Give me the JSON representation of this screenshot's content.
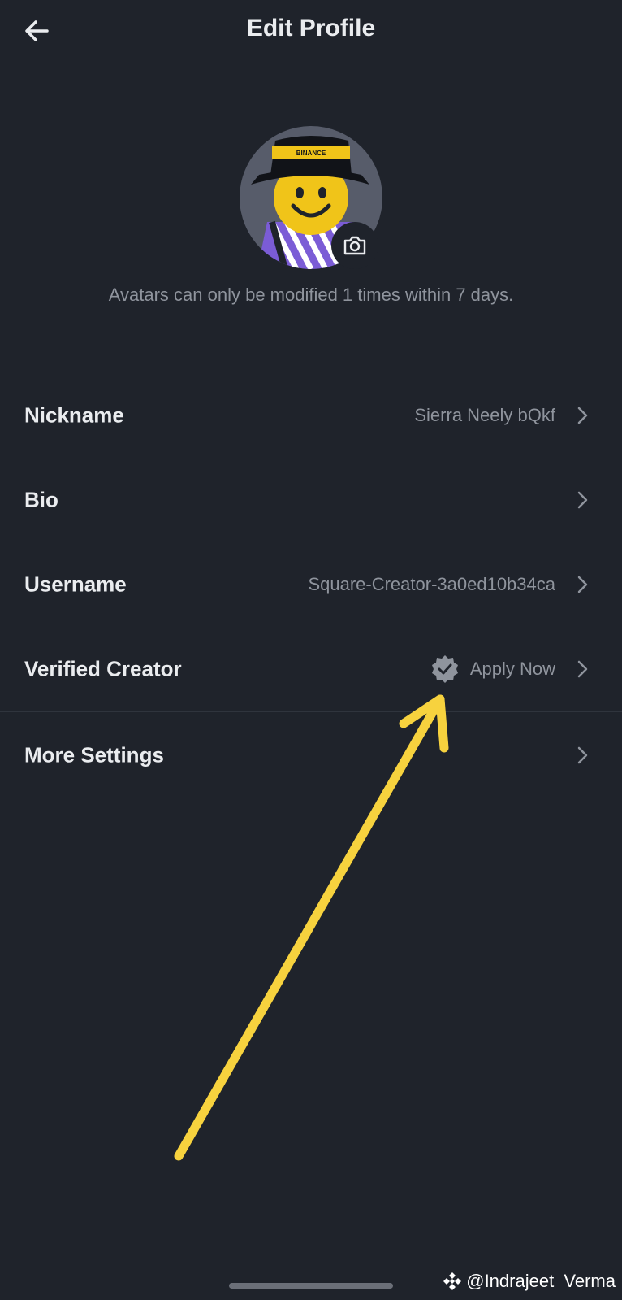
{
  "header": {
    "title": "Edit Profile"
  },
  "avatar": {
    "note": "Avatars can only be modified 1 times within 7 days.",
    "hat_text": "BINANCE"
  },
  "rows": {
    "nickname": {
      "label": "Nickname",
      "value": "Sierra Neely bQkf"
    },
    "bio": {
      "label": "Bio",
      "value": ""
    },
    "username": {
      "label": "Username",
      "value": "Square-Creator-3a0ed10b34ca"
    },
    "verified": {
      "label": "Verified Creator",
      "value": "Apply Now"
    },
    "more": {
      "label": "More Settings"
    }
  },
  "watermark": {
    "text": "@Indrajeet  Verma"
  },
  "colors": {
    "background": "#1f232b",
    "text_primary": "#eaecef",
    "text_secondary": "#8f949d",
    "annotation_arrow": "#f7d23e",
    "avatar_yellow": "#f0c419",
    "avatar_purple": "#7b5cd6"
  }
}
